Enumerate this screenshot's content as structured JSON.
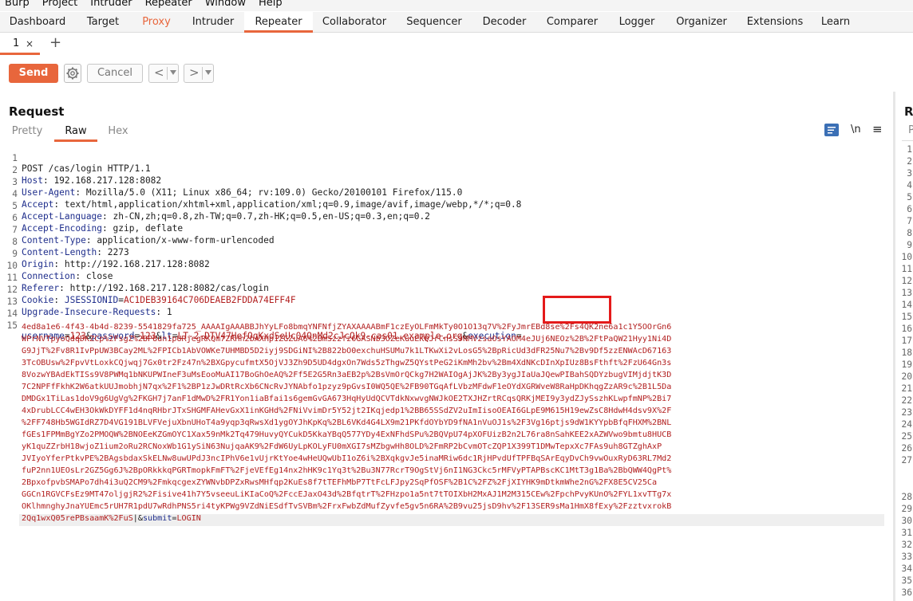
{
  "menu": [
    "Burp",
    "Project",
    "Intruder",
    "Repeater",
    "Window",
    "Help"
  ],
  "main_tabs": [
    {
      "label": "Dashboard"
    },
    {
      "label": "Target"
    },
    {
      "label": "Proxy"
    },
    {
      "label": "Intruder"
    },
    {
      "label": "Repeater"
    },
    {
      "label": "Collaborator"
    },
    {
      "label": "Sequencer"
    },
    {
      "label": "Decoder"
    },
    {
      "label": "Comparer"
    },
    {
      "label": "Logger"
    },
    {
      "label": "Organizer"
    },
    {
      "label": "Extensions"
    },
    {
      "label": "Learn"
    }
  ],
  "active_main_tab": "Repeater",
  "sub_tab": {
    "label": "1",
    "close": "×",
    "add": "+"
  },
  "toolbar": {
    "send": "Send",
    "cancel": "Cancel",
    "back": "<",
    "forward": ">"
  },
  "request": {
    "title": "Request",
    "tabs": [
      "Pretty",
      "Raw",
      "Hex"
    ],
    "active_tab": "Raw",
    "newline_toggle": "\\n",
    "menu_icon": "≡",
    "headers": [
      {
        "n": "1",
        "text": "POST /cas/login HTTP/1.1"
      },
      {
        "n": "2",
        "name": "Host",
        "value": "192.168.217.128:8082"
      },
      {
        "n": "3",
        "name": "User-Agent",
        "value": "Mozilla/5.0 (X11; Linux x86_64; rv:109.0) Gecko/20100101 Firefox/115.0"
      },
      {
        "n": "4",
        "name": "Accept",
        "value": "text/html,application/xhtml+xml,application/xml;q=0.9,image/avif,image/webp,*/*;q=0.8"
      },
      {
        "n": "5",
        "name": "Accept-Language",
        "value": "zh-CN,zh;q=0.8,zh-TW;q=0.7,zh-HK;q=0.5,en-US;q=0.3,en;q=0.2"
      },
      {
        "n": "6",
        "name": "Accept-Encoding",
        "value": "gzip, deflate"
      },
      {
        "n": "7",
        "name": "Content-Type",
        "value": "application/x-www-form-urlencoded"
      },
      {
        "n": "8",
        "name": "Content-Length",
        "value": "2273"
      },
      {
        "n": "9",
        "name": "Origin",
        "value": "http://192.168.217.128:8082"
      },
      {
        "n": "10",
        "name": "Connection",
        "value": "close"
      },
      {
        "n": "11",
        "name": "Referer",
        "value": "http://192.168.217.128:8082/cas/login"
      },
      {
        "n": "12",
        "name": "Cookie",
        "cookie_name": "JSESSIONID",
        "cookie_value": "AC1DEB39164C706DEAEB2FDDA74EFF4F"
      },
      {
        "n": "13",
        "name": "Upgrade-Insecure-Requests",
        "value": "1"
      },
      {
        "n": "14",
        "text": ""
      }
    ],
    "body_line_number": "15",
    "body_first": {
      "p1": "username",
      "v1": "123",
      "p2": "password",
      "v2": "123",
      "p3": "lt",
      "v3": "LT-2-DTV47HefOqKxdSeUc04QnMd2cJcQk9-cas01.example.org",
      "p4": "execution"
    },
    "body_lines": [
      "4ed8a1e6-4f43-4b4d-8239-5541829fa725_AAAAIgAAABBJhYyLFo8bmqYNFNfjZYAXAAAABmF1czEyOLFmMkTy0O1O13q7V%2FyJmrEBd8se%2Fs4QK2ne6a1c1Y5OOrGn6",
      "WPrNVTpyoQdqDKZCp%2FsgZ%2BP8un1pURjegRKQm7ZRHh2bAXHp1ZGZuA6%2BmSzzfz6GASNb3OZeKuuEKQJrCnsS9NMVzsaOsYAOM4eJUj6NEOz%2B%2FtPaQW21Hyy1Ni4D",
      "G9JjT%2Fv8R1IvPpUW3BCay2ML%2FPICb1AbVOWKe7UHMBD5D2iyj9SDGiNI%2B822bO0exchuHSUMu7k1LTKwXi2vLosG5%2BpRicUd3dFR25Nu7%2Bv9Df5zzENWAcD67163",
      "3TcOBUsw%2FpvVtLoxkCQjwqj7Gx0tr2Fz47n%2BXGpycufmtX5OjVJ3Zh9D5UD4dgxOn7Wds5zThgwZ5QYstPeG2iKmMh2bv%2Bm4XdNKcDInXpIUz8BsFthft%2FzU64Gn3s",
      "8VozwYBAdEkTISs9V8PWMq1bNKUPWIneF3uMsEooMuAI17BoGhOeAQ%2Ff5E2G5Rn3aEB2p%2BsVmOrQCkg7H2WAIOgAjJK%2By3ygJIaUaJQewPIBahSQDYzbugVIMjdjtK3D",
      "7C2NPFfFkhK2W6atkUUJmobhjN7qx%2F1%2BP1zJwDRtRcXb6CNcRvJYNAbfo1pzyz9pGvsI0WQ5QE%2FB90TGqAfLVbzMFdwF1eOYdXGRWveW8RaHpDKhqgZzAR9c%2B1L5Da",
      "DMDGx1TiLas1doV9g6UgVg%2FKGH7j7anF1dMwD%2FR1Yon1iaBfai1s6gemGvGA673HqHyUdQCVTdkNxwvgNWJkOE2TXJHZrtRCqsQRKjMEI9y3ydZJySszhKLwpfmNP%2Bi7",
      "4xDrubLCC4wEH3OkWkDYFF1d4nqRHbrJTxSHGMFAHevGxX1inKGHd%2FNiVvimDr5Y52jt2IKqjedp1%2BB65SSdZV2uImIisoOEAI6GLpE9M615H19ewZsC8HdwH4dsv9X%2F",
      "%2FF748Hb5WGIdRZ7D4VG191BLVFVejuXbnUHoT4a9yqp3qRwsXd1ygOYJhKpKq%2BL6VKd4G4LX9m21PKfdOYbYD9fNA1nVuOJ1s%2F3Vg16ptjs9dW1KYYpbBfqFHXM%2BNL",
      "fGEs1FPMmBgYZo2PMOQW%2BNOEeKZGmOYC1Xax59nMk2Tq479HuvyQYCukD5KkaYBqQ577YDy4ExNFhdSPu%2BQVpU74pXOFUizB2n2L76ra8nSahKEE2xAZWVwo9bmtu8HUCB",
      "yK1quZZrbH18wjoZ1ium2oRu2RCNoxWb1G1ySiN63NujqaAK9%2FdW6UyLpKOLyFU0mXGI7sMZbgwHh8OLD%2FmRP2bCvmOTcZQP1X399T1DMwTepxXc7FAs9uh8GTZghAxP",
      "JVIyoYferPtkvPE%2BAgsbdaxSkELNw8uwUPdJ3ncIPhV6e1vUjrKtYoe4wHeUQwUbI1oZ6i%2BXqkgvJe5inaMRiw6dc1RjHPvdUfTPFBqSArEqyDvCh9vwOuxRyD63RL7Md2",
      "fuP2nn1UEOsLr2GZ5Gg6J%2BpORkkkqPGRTmopkFmFT%2FjeVEfEg14nx2hHK9c1Yq3t%2Bu3N77RcrT9OgStVj6nI1NG3Ckc5rMFVyPTAPBscKC1MtT3g1Ba%2BbQWW4QgPt%",
      "2BpxofpvbSMAPo7dh4i3uQ2CM9%2FmkqcgexZYWNvbDPZxRwsMHfqp2KuEs8f7tTEFhMbP7TtFcLFJpy2SqPfOSF%2B1C%2FZ%2FjXIYHK9mDtkmWhe2nG%2FX8E5CV25Ca",
      "GGCn1RGVCFsEz9MT47oljgjR2%2Fisive41h7Y5vseeuLiKIaCoQ%2FccEJaxO43d%2BfqtrT%2FHzpo1a5nt7tTOIXbH2MxAJ1M2M315CEw%2FpchPvyKUnO%2FYL1xvTTg7x",
      "OKlhmnghyJnaYUEmc5rUH7R1pdU7wRdhPNS5ri4tyKPWg9VZdNiESdfTvSVBm%2FrxFwbZdMufZyvfe5gv5n6RA%2B9vu25jsD9hv%2F13SER9sMa1HmX8fExy%2FzztvxrokB"
    ],
    "body_last": {
      "value": "2Qq1wxQ05rePBsaamK%2FuS",
      "p5": "submit",
      "v5": "LOGIN"
    }
  },
  "response_panel": {
    "title": "R",
    "tab": "P"
  },
  "right_gutter_numbers": [
    "1",
    "2",
    "3",
    "4",
    "5",
    "6",
    "7",
    "8",
    "9",
    "10",
    "11",
    "12",
    "13",
    "14",
    "15",
    "16",
    "17",
    "18",
    "19",
    "20",
    "21",
    "22",
    "23",
    "24",
    "25",
    "26",
    "27",
    "28",
    "29",
    "30",
    "31",
    "32",
    "33",
    "34",
    "35",
    "36"
  ]
}
